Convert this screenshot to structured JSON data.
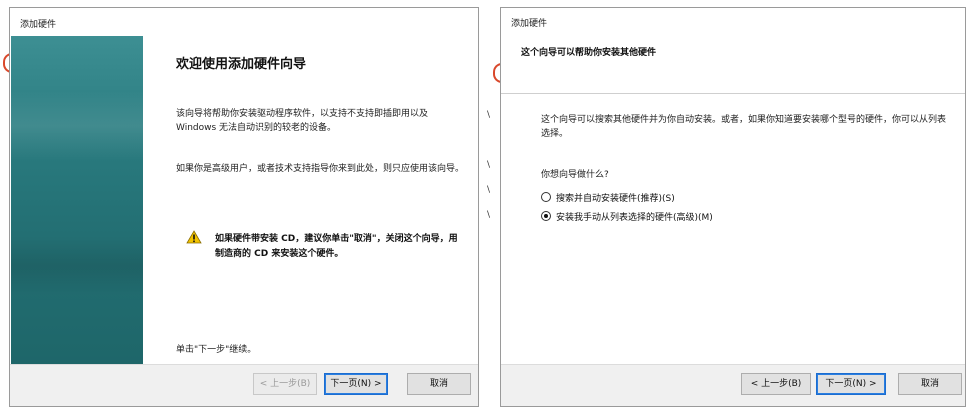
{
  "left_dialog": {
    "title": "添加硬件",
    "heading": "欢迎使用添加硬件向导",
    "para1": "该向导将帮助你安装驱动程序软件，以支持不支持即插即用以及Windows 无法自动识别的较老的设备。",
    "para2": "如果你是高级用户，或者技术支持指导你来到此处，则只应使用该向导。",
    "warning": "如果硬件带安装 CD，建议你单击\"取消\"，关闭这个向导，用制造商的 CD 来安装这个硬件。",
    "continue_hint": "单击\"下一步\"继续。",
    "buttons": {
      "back": "< 上一步(B)",
      "next": "下一页(N) >",
      "cancel": "取消"
    }
  },
  "right_dialog": {
    "title": "添加硬件",
    "header": "这个向导可以帮助你安装其他硬件",
    "description": "这个向导可以搜索其他硬件并为你自动安装。或者，如果你知道要安装哪个型号的硬件，你可以从列表选择。",
    "question": "你想向导做什么?",
    "options": [
      {
        "label": "搜索并自动安装硬件(推荐)(S)",
        "selected": false
      },
      {
        "label": "安装我手动从列表选择的硬件(高级)(M)",
        "selected": true
      }
    ],
    "buttons": {
      "back": "< 上一步(B)",
      "next": "下一页(N) >",
      "cancel": "取消"
    }
  },
  "colors": {
    "side_panel": "#2a7c80",
    "warning_yellow": "#f2c300",
    "primary_border": "#1c6dd0",
    "background_accent": "#d9482b"
  },
  "icons": {
    "warning": "warning-triangle-icon"
  }
}
